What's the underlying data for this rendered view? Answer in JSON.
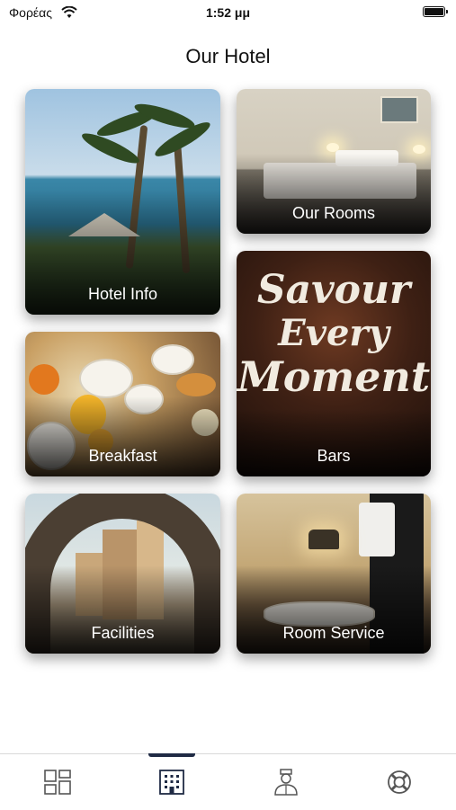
{
  "status_bar": {
    "carrier": "Φορέας",
    "time": "1:52 μμ"
  },
  "header": {
    "title": "Our Hotel"
  },
  "tiles": [
    {
      "label": "Hotel Info"
    },
    {
      "label": "Our Rooms"
    },
    {
      "label": "Bars",
      "image_text": [
        "Savour",
        "Every",
        "Moment"
      ]
    },
    {
      "label": "Breakfast"
    },
    {
      "label": "Facilities"
    },
    {
      "label": "Room Service"
    }
  ],
  "tab_bar": {
    "selected_index": 1,
    "icons": [
      "dashboard-icon",
      "hotel-building-icon",
      "concierge-icon",
      "lifebuoy-icon"
    ],
    "accent": "#1f2a44"
  }
}
